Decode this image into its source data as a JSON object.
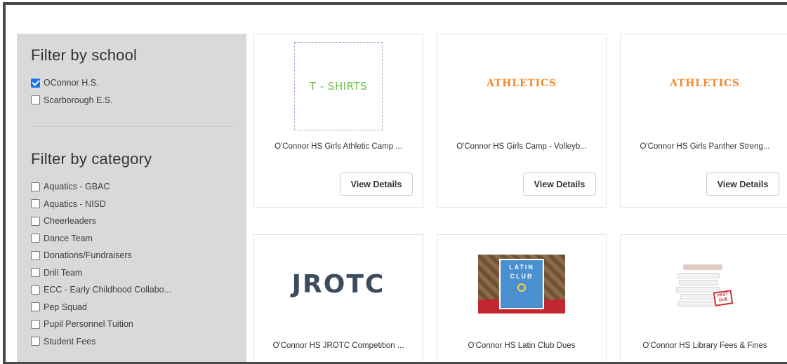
{
  "sidebar": {
    "school_title": "Filter by school",
    "schools": [
      {
        "label": "OConnor H.S.",
        "checked": true
      },
      {
        "label": "Scarborough E.S.",
        "checked": false
      }
    ],
    "category_title": "Filter by category",
    "categories": [
      {
        "label": "Aquatics - GBAC",
        "checked": false
      },
      {
        "label": "Aquatics - NISD",
        "checked": false
      },
      {
        "label": "Cheerleaders",
        "checked": false
      },
      {
        "label": "Dance Team",
        "checked": false
      },
      {
        "label": "Donations/Fundraisers",
        "checked": false
      },
      {
        "label": "Drill Team",
        "checked": false
      },
      {
        "label": "ECC - Early Childhood Collabo...",
        "checked": false
      },
      {
        "label": "Pep Squad",
        "checked": false
      },
      {
        "label": "Pupil Personnel Tuition",
        "checked": false
      },
      {
        "label": "Student Fees",
        "checked": false
      }
    ]
  },
  "products": [
    {
      "image_text": "T - SHIRTS",
      "title": "O'Connor HS Girls Athletic Camp ...",
      "button": "View Details"
    },
    {
      "image_text": "ATHLETICS",
      "title": "O'Connor HS Girls Camp - Volleyb...",
      "button": "View Details"
    },
    {
      "image_text": "ATHLETICS",
      "title": "O'Connor HS Girls Panther Streng...",
      "button": "View Details"
    },
    {
      "image_text": "JROTC",
      "title": "O'Connor HS JROTC Competition ..."
    },
    {
      "image_text_line1": "LATIN",
      "image_text_line2": "CLUB",
      "title": "O'Connor HS Latin Club Dues"
    },
    {
      "stamp_line1": "PAST",
      "stamp_line2": "DUE",
      "title": "O'Connor HS Library Fees & Fines"
    }
  ],
  "colors": {
    "checkbox_accent": "#1a73e8",
    "sidebar_bg": "#d9d9d9",
    "tshirt_text": "#6cc24a",
    "athletics_text": "#f28a2e",
    "jrotc_text": "#3c4b5e"
  }
}
